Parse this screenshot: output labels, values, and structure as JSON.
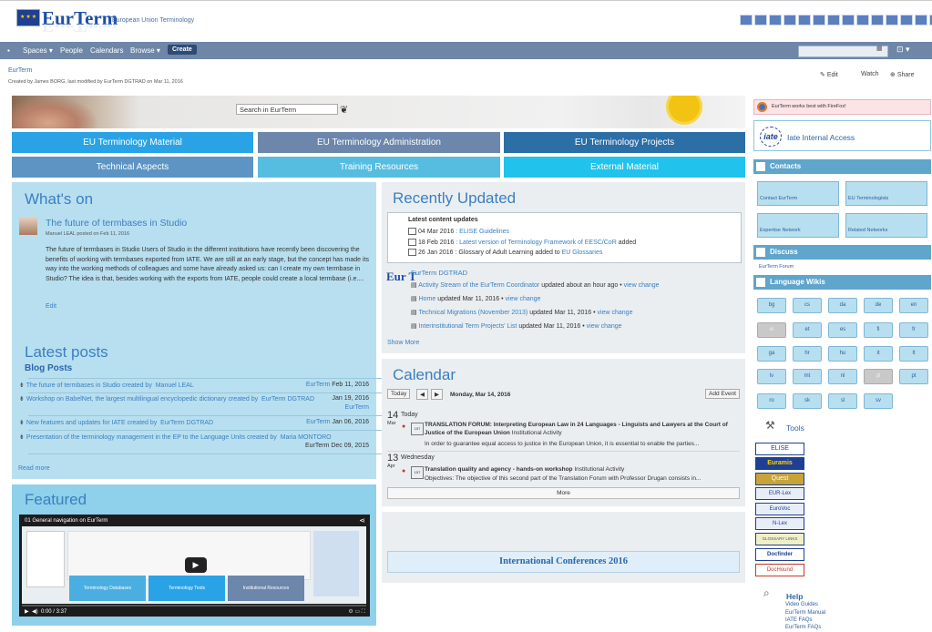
{
  "header": {
    "logo": "EurTerm",
    "subtitle": "European Union Terminology"
  },
  "nav": {
    "items": [
      "Spaces ▾",
      "People",
      "Calendars",
      "Browse ▾"
    ],
    "create": "Create"
  },
  "page": {
    "breadcrumb": "EurTerm",
    "byline": "Created by James BORG, last modified by EurTerm DGTRAD on Mar 11, 2016",
    "actions": [
      "Edit",
      "Watch",
      "Share"
    ]
  },
  "banner": {
    "search": "Search in EurTerm"
  },
  "tiles": [
    "EU Terminology Material",
    "EU Terminology Administration",
    "EU Terminology Projects",
    "Technical Aspects",
    "Training Resources",
    "External Material"
  ],
  "whats_on": {
    "heading": "What's on",
    "post_title": "The future of termbases in Studio",
    "post_meta": "Manuel LEAL posted on Feb 11, 2016",
    "post_body": "The future of termbases in Studio   Users of Studio in the different institutions have recently been discovering the benefits of working with termbases exported from IATE. We are still at an early stage, but the concept has made its way into the working methods of colleagues and some have already asked us: can I create my own termbase in Studio? The idea is that, besides working with the exports from IATE, people could create a local termbase (i.e....",
    "edit": "Edit"
  },
  "latest_posts": {
    "heading": "Latest posts",
    "subheading": "Blog Posts",
    "items": [
      {
        "text": "The future of termbases in Studio created by",
        "author": "Manuel LEAL",
        "space": "EurTerm",
        "date": "Feb 11, 2016",
        "space2": ""
      },
      {
        "text": "Workshop on BabelNet, the largest multilingual encyclopedic dictionary created by",
        "author": "EurTerm DGTRAD",
        "space": "",
        "date": "Jan 19, 2016",
        "space2": "EurTerm"
      },
      {
        "text": "New features and updates for IATE created by",
        "author": "EurTerm DGTRAD",
        "space": "EurTerm",
        "date": "Jan 06, 2016",
        "space2": ""
      },
      {
        "text": "Presentation of the terminology management in the EP to the Language Units created by",
        "author": "Maria MONTORO",
        "space": "",
        "date": "",
        "space2": "EurTerm Dec 09, 2015"
      }
    ],
    "read_more": "Read more"
  },
  "featured": {
    "heading": "Featured",
    "video_title": "01 General navigation on EurTerm",
    "video_time": "0:00 / 3:37",
    "cards": [
      "Terminology Databases",
      "Terminology Tools",
      "Institutional Resources"
    ]
  },
  "recent": {
    "heading": "Recently Updated",
    "box_title": "Latest content updates",
    "box_items": [
      {
        "date": "04 Mar 2016",
        "text": ": ELISE Guidelines",
        "after": ""
      },
      {
        "date": "18 Feb 2016",
        "text": ": Latest version of Terminology Framework of EESC/CoR",
        "after": " added"
      },
      {
        "date": "26 Jan 2016",
        "text": ": Glossary of Adult Learning added to ",
        "after": "EU Glossaries"
      }
    ],
    "user": "EurTerm DGTRAD",
    "activity": [
      {
        "title": "Activity Stream of the EurTerm Coordinator",
        "meta": " updated about an hour ago • ",
        "view": "view change"
      },
      {
        "title": "Home",
        "meta": " updated Mar 11, 2016 • ",
        "view": "view change"
      },
      {
        "title": "Technical Migrations (November 2013)",
        "meta": " updated Mar 11, 2016 • ",
        "view": "view change"
      },
      {
        "title": "Interinstitutional Term Projects' List",
        "meta": " updated Mar 11, 2016 • ",
        "view": "view change"
      }
    ],
    "show_more": "Show More"
  },
  "calendar": {
    "heading": "Calendar",
    "today_btn": "Today",
    "date": "Monday, Mar 14, 2016",
    "add_event": "Add Event",
    "days": [
      {
        "num": "14",
        "mon": "Mar",
        "label": "Today",
        "title": "TRANSLATION FORUM: Interpreting European Law in 24 Languages - Linguists and Lawyers at the Court of Justice of the European Union",
        "cat": " Institutional Activity",
        "desc": "In order to guarantee equal access to justice in the European Union, it is essential to enable the parties..."
      },
      {
        "num": "13",
        "mon": "Apr",
        "label": "Wednesday",
        "title": "Translation quality and agency - hands-on workshop",
        "cat": " Institutional Activity",
        "desc": "Objectives: The objective of this second part of the Translation Forum with Professor Drugan consists in..."
      }
    ],
    "more": "More"
  },
  "conferences": "International Conferences 2016",
  "right": {
    "firefox": "EurTerm works best with FireFox!",
    "iate": "Iate Internal Access",
    "iate_logo": "iate",
    "contacts": "Contacts",
    "contact_tiles": [
      "Contact EurTerm",
      "EU Terminologists",
      "Expertise Network",
      "Related Networks"
    ],
    "discuss": "Discuss",
    "forum": "EurTerm Forum",
    "wikis": "Language Wikis",
    "langs": [
      "bg",
      "cs",
      "da",
      "de",
      "en",
      "el",
      "et",
      "es",
      "fi",
      "fr",
      "ga",
      "hr",
      "hu",
      "it",
      "lt",
      "lv",
      "mt",
      "nl",
      "pl",
      "pt",
      "ro",
      "sk",
      "sl",
      "sv"
    ],
    "tools": "Tools",
    "tool_logos": [
      "ELISE",
      "Euramis",
      "Quest",
      "EUR-Lex",
      "EuroVoc",
      "N-Lex",
      "GLOSSARY LINKS",
      "Docfinder",
      "DocHound"
    ],
    "help": "Help",
    "help_links": [
      "Video Guides",
      "EurTerm Manual",
      "IATE FAQs",
      "EurTerm FAQs"
    ]
  }
}
